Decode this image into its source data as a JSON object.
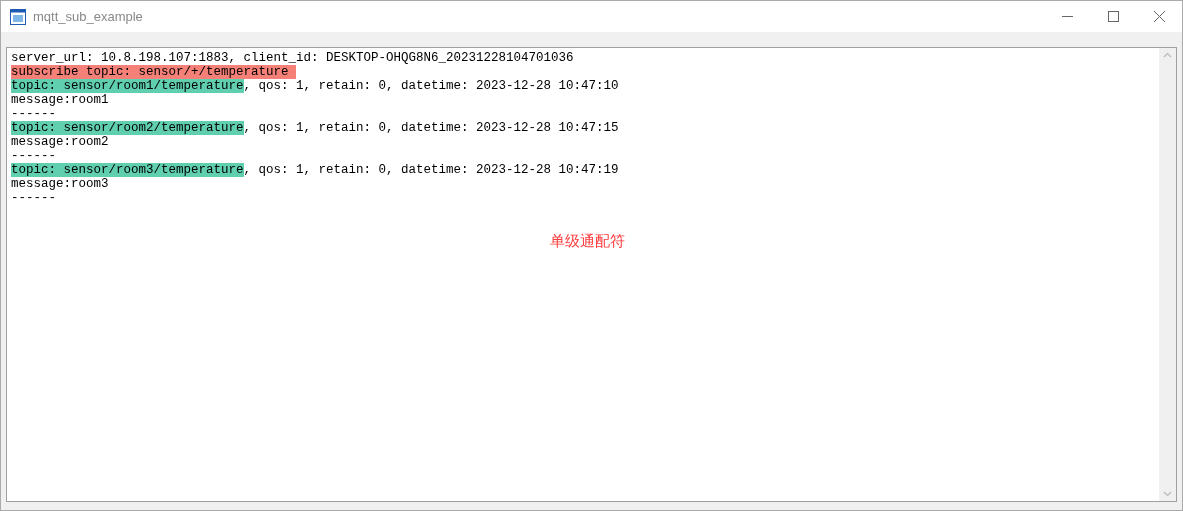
{
  "window": {
    "title": "mqtt_sub_example"
  },
  "log": [
    {
      "kind": "plain",
      "text": "server_url: 10.8.198.107:1883, client_id: DESKTOP-OHQG8N6_20231228104701036"
    },
    {
      "kind": "subscribe",
      "text": "subscribe topic: sensor/+/temperature "
    },
    {
      "kind": "topic",
      "topic": "topic: sensor/room1/temperature",
      "rest": ", qos: 1, retain: 0, datetime: 2023-12-28 10:47:10"
    },
    {
      "kind": "plain",
      "text": "message:room1"
    },
    {
      "kind": "plain",
      "text": "------"
    },
    {
      "kind": "topic",
      "topic": "topic: sensor/room2/temperature",
      "rest": ", qos: 1, retain: 0, datetime: 2023-12-28 10:47:15"
    },
    {
      "kind": "plain",
      "text": "message:room2"
    },
    {
      "kind": "plain",
      "text": "------"
    },
    {
      "kind": "topic",
      "topic": "topic: sensor/room3/temperature",
      "rest": ", qos: 1, retain: 0, datetime: 2023-12-28 10:47:19"
    },
    {
      "kind": "plain",
      "text": "message:room3"
    },
    {
      "kind": "plain",
      "text": "------"
    }
  ],
  "annotation": "单级通配符"
}
